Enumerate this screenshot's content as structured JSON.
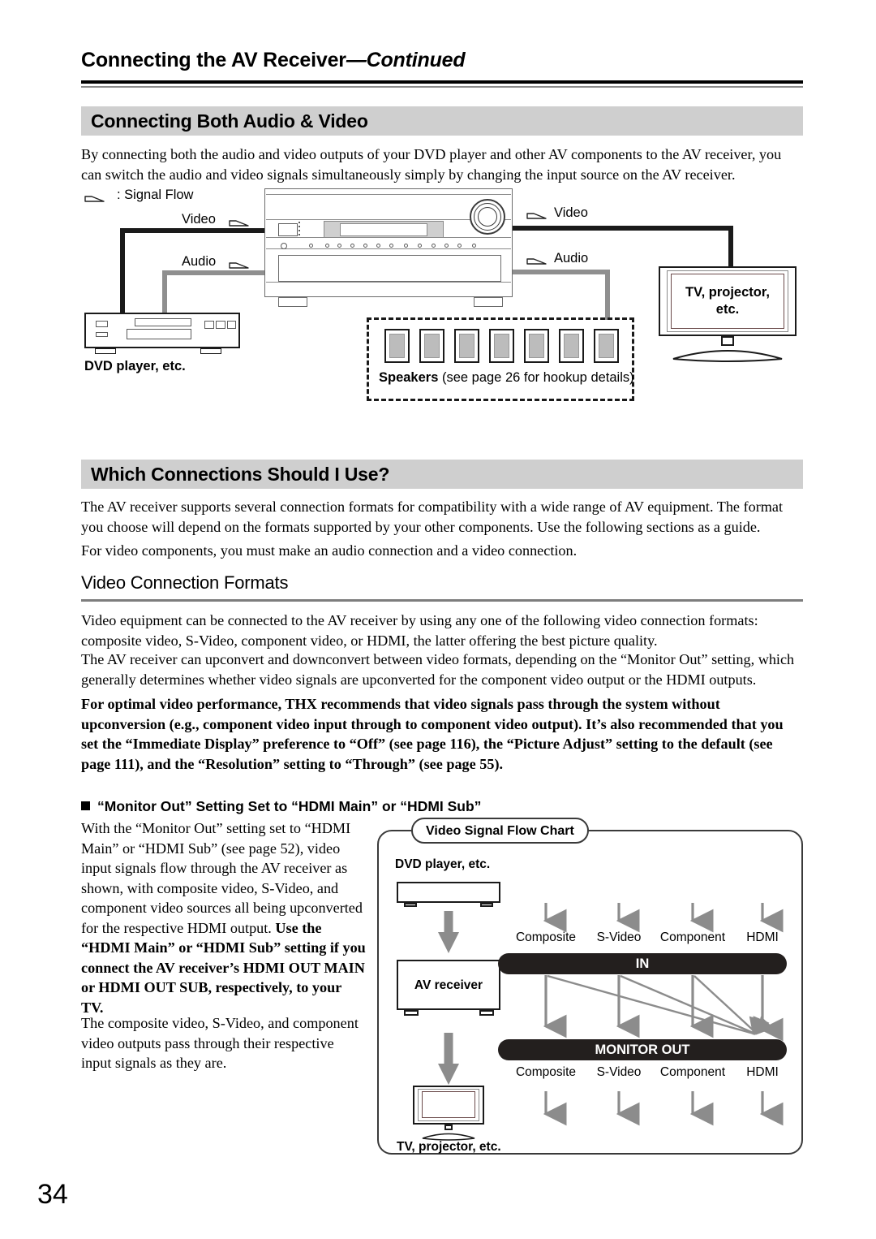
{
  "page": {
    "running_head_main": "Connecting the AV Receiver",
    "running_head_cont": "—Continued",
    "page_number": "34"
  },
  "sections": {
    "audio_video": {
      "title": "Connecting Both Audio & Video",
      "intro": "By connecting both the audio and video outputs of your DVD player and other AV components to the AV receiver, you can switch the audio and video signals simultaneously simply by changing the input source on the AV receiver."
    },
    "which_connections": {
      "title": "Which Connections Should I Use?",
      "p1": "The AV receiver supports several connection formats for compatibility with a wide range of AV equipment. The format you choose will depend on the formats supported by your other components. Use the following sections as a guide.",
      "p2": "For video components, you must make an audio connection and a video connection."
    },
    "video_formats": {
      "subhead": "Video Connection Formats",
      "p1": "Video equipment can be connected to the AV receiver by using any one of the following video connection formats: composite video, S-Video, component video, or HDMI, the latter offering the best picture quality.",
      "p2": "The AV receiver can upconvert and downconvert between video formats, depending on the “Monitor Out” setting, which generally determines whether video signals are upconverted for the component video output or the HDMI outputs.",
      "p3_bold": "For optimal video performance, THX recommends that video signals pass through the system without upconversion (e.g., component video input through to component video output). It’s also recommended that you set the “Immediate Display” preference to “Off” (see page 116), the “Picture Adjust” setting to the default (see page 111), and the “Resolution” setting to “Through” (see page 55)."
    },
    "monitor_out": {
      "heading": "“Monitor Out” Setting Set to “HDMI Main” or “HDMI Sub”",
      "p1_plain": "With the “Monitor Out” setting set to “HDMI Main” or “HDMI Sub” (see page 52), video input signals flow through the AV receiver as shown, with composite video, S-Video, and component video sources all being upconverted for the respective HDMI output. ",
      "p1_bold": "Use the “HDMI Main” or “HDMI Sub” setting if you connect the AV receiver’s HDMI OUT MAIN or HDMI OUT SUB, respectively, to your TV.",
      "p2": "The composite video, S-Video, and component video outputs pass through their respective input signals as they are."
    }
  },
  "hookup_diagram": {
    "legend": ": Signal Flow",
    "left_video_label": "Video",
    "left_audio_label": "Audio",
    "right_video_label": "Video",
    "right_audio_label": "Audio",
    "dvd_label": "DVD player, etc.",
    "tv_label_line1": "TV, projector,",
    "tv_label_line2": "etc.",
    "speakers_label_bold": "Speakers",
    "speakers_label_rest": " (see page 26 for hookup details)",
    "speaker_count": 7,
    "colors": {
      "video_cable": "#1a1a1a",
      "audio_cable": "#8f8f8f",
      "speaker_cone": "#bcbcbc",
      "section_bar": "#cfcfcf"
    }
  },
  "chart_data": {
    "type": "diagram",
    "title": "Video Signal Flow Chart",
    "device_top_label": "DVD player, etc.",
    "device_mid_label": "AV receiver",
    "device_bottom_label": "TV, projector, etc.",
    "bar_in_label": "IN",
    "bar_out_label": "MONITOR OUT",
    "in_formats": [
      "Composite",
      "S-Video",
      "Component",
      "HDMI"
    ],
    "out_formats": [
      "Composite",
      "S-Video",
      "Component",
      "HDMI"
    ],
    "routes_straight": [
      {
        "from": "Composite",
        "to": "Composite"
      },
      {
        "from": "S-Video",
        "to": "S-Video"
      },
      {
        "from": "Component",
        "to": "Component"
      },
      {
        "from": "HDMI",
        "to": "HDMI"
      }
    ],
    "routes_upconvert": [
      {
        "from": "Composite",
        "to": "HDMI"
      },
      {
        "from": "S-Video",
        "to": "HDMI"
      },
      {
        "from": "Component",
        "to": "HDMI"
      }
    ],
    "colors": {
      "bar_fill": "#231f1e",
      "bar_text": "#ffffff",
      "arrow": "#808080"
    }
  }
}
